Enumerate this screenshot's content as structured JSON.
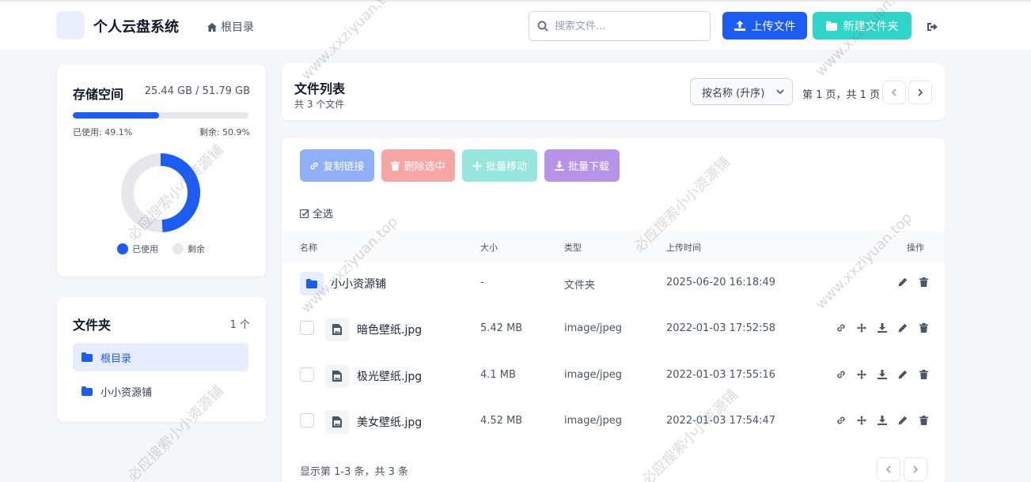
{
  "header": {
    "app_title": "个人云盘系统",
    "root_link": "根目录",
    "search_placeholder": "搜索文件...",
    "upload_label": "上传文件",
    "new_folder_label": "新建文件夹"
  },
  "storage": {
    "title": "存储空间",
    "amount": "25.44 GB / 51.79 GB",
    "used_label": "已使用: 49.1%",
    "remain_label": "剩余: 50.9%",
    "used_fraction": 0.491,
    "legend_used": "已使用",
    "legend_remain": "剩余",
    "used_color": "#1a5cf5",
    "remain_color": "#e5e7eb"
  },
  "folders": {
    "title": "文件夹",
    "count": "1 个",
    "items": [
      {
        "label": "根目录"
      },
      {
        "label": "小小资源铺"
      }
    ]
  },
  "file_list": {
    "title": "文件列表",
    "subtitle": "共 3 个文件",
    "sort_value": "按名称 (升序)",
    "page_info": "第 1 页，共 1 页"
  },
  "actions": {
    "copy_link": "复制链接",
    "delete_selected": "删除选中",
    "batch_move": "批量移动",
    "batch_download": "批量下载",
    "select_all": "全选"
  },
  "table": {
    "headers": {
      "name": "名称",
      "size": "大小",
      "type": "类型",
      "uploaded": "上传时间",
      "ops": "操作"
    },
    "rows": [
      {
        "name": "小小资源铺",
        "size": "-",
        "type": "文件夹",
        "uploaded": "2025-06-20 16:18:49"
      },
      {
        "name": "暗色壁纸.jpg",
        "size": "5.42 MB",
        "type": "image/jpeg",
        "uploaded": "2022-01-03 17:52:58"
      },
      {
        "name": "极光壁纸.jpg",
        "size": "4.1 MB",
        "type": "image/jpeg",
        "uploaded": "2022-01-03 17:55:16"
      },
      {
        "name": "美女壁纸.jpg",
        "size": "4.52 MB",
        "type": "image/jpeg",
        "uploaded": "2022-01-03 17:54:47"
      }
    ]
  },
  "footer": {
    "info": "显示第 1-3 条，共 3 条"
  },
  "watermark": {
    "text_a": "www.xxziyuan.top",
    "text_b": "必应搜索小小资源铺"
  }
}
